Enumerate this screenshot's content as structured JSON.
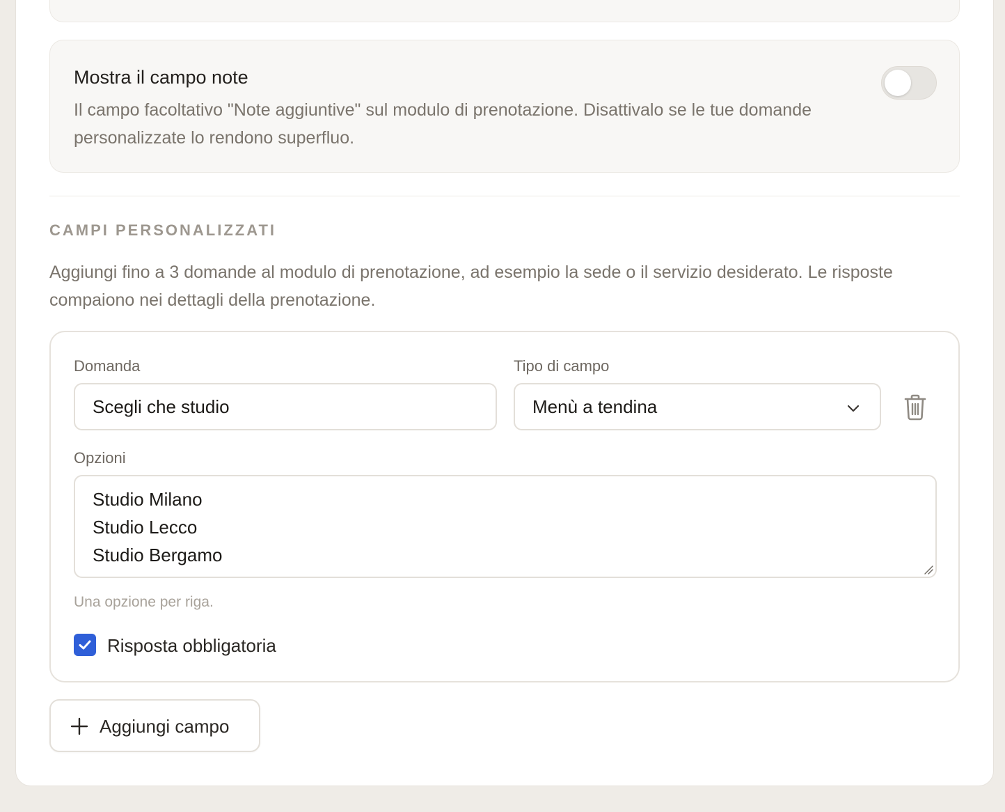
{
  "notes_setting": {
    "title": "Mostra il campo note",
    "description": "Il campo facoltativo \"Note aggiuntive\" sul modulo di prenotazione. Disattivalo se le tue domande personalizzate lo rendono superfluo.",
    "enabled": false
  },
  "custom_fields": {
    "heading": "CAMPI PERSONALIZZATI",
    "description": "Aggiungi fino a 3 domande al modulo di prenotazione, ad esempio la sede o il servizio desiderato. Le risposte compaiono nei dettagli della prenotazione.",
    "field": {
      "question_label": "Domanda",
      "question_value": "Scegli che studio",
      "type_label": "Tipo di campo",
      "type_value": "Menù a tendina",
      "options_label": "Opzioni",
      "options": [
        "Studio Milano",
        "Studio Lecco",
        "Studio Bergamo"
      ],
      "options_hint": "Una opzione per riga.",
      "required_label": "Risposta obbligatoria",
      "required": true
    },
    "add_button_label": "Aggiungi campo"
  },
  "icons": {
    "select": "chevron-down-icon",
    "delete": "trash-icon",
    "check": "check-icon",
    "add": "plus-icon"
  },
  "colors": {
    "accent": "#2f5fd8",
    "page_background": "#efece7",
    "muted_text": "#7a746c"
  }
}
